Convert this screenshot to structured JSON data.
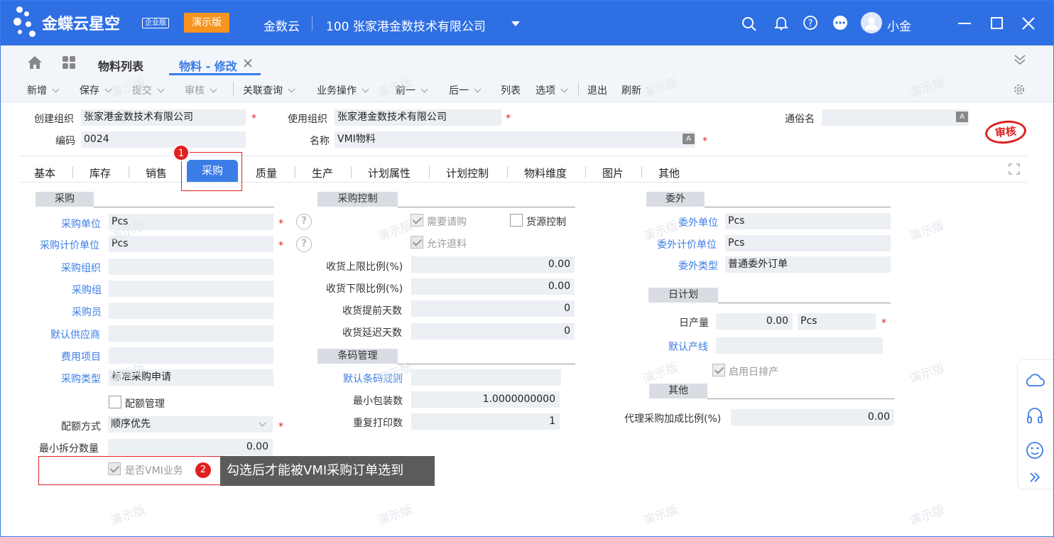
{
  "app": {
    "brand": "金蝶云星空",
    "edition": "企业版",
    "demo": "演示版",
    "product": "金数云",
    "company": "100 张家港金数技术有限公司",
    "user": "小金"
  },
  "tabs": {
    "list": "物料列表",
    "edit": "物料 - 修改"
  },
  "toolbar": {
    "new": "新增",
    "save": "保存",
    "submit": "提交",
    "audit": "审核",
    "query": "关联查询",
    "ops": "业务操作",
    "prev": "前一",
    "next": "后一",
    "list": "列表",
    "options": "选项",
    "exit": "退出",
    "refresh": "刷新"
  },
  "header": {
    "create_org_label": "创建组织",
    "create_org": "张家港金数技术有限公司",
    "use_org_label": "使用组织",
    "use_org": "张家港金数技术有限公司",
    "alias_label": "通俗名",
    "alias": "",
    "code_label": "编码",
    "code": "0024",
    "name_label": "名称",
    "name": "VMI物料",
    "stamp": "审核"
  },
  "ctabs": [
    "基本",
    "库存",
    "销售",
    "采购",
    "质量",
    "生产",
    "计划属性",
    "计划控制",
    "物料维度",
    "图片",
    "其他"
  ],
  "purchase": {
    "title": "采购",
    "unit_label": "采购单位",
    "unit": "Pcs",
    "price_unit_label": "采购计价单位",
    "price_unit": "Pcs",
    "org_label": "采购组织",
    "org": "",
    "group_label": "采购组",
    "group": "",
    "buyer_label": "采购员",
    "buyer": "",
    "supplier_label": "默认供应商",
    "supplier": "",
    "expense_label": "费用项目",
    "expense": "",
    "type_label": "采购类型",
    "type": "标准采购申请",
    "quota_label": "配额管理",
    "quota_mode_label": "配额方式",
    "quota_mode": "顺序优先",
    "min_split_label": "最小拆分数量",
    "min_split": "0.00",
    "vmi_label": "是否VMI业务"
  },
  "control": {
    "title": "采购控制",
    "need_req": "需要请购",
    "source_ctrl": "货源控制",
    "allow_return": "允许退料",
    "upper_label": "收货上限比例(%)",
    "upper": "0.00",
    "lower_label": "收货下限比例(%)",
    "lower": "0.00",
    "ahead_label": "收货提前天数",
    "ahead": "0",
    "delay_label": "收货延迟天数",
    "delay": "0"
  },
  "barcode": {
    "title": "条码管理",
    "rule_label": "默认条码规则",
    "rule": "",
    "min_pack_label": "最小包装数",
    "min_pack": "1.0000000000",
    "reprint_label": "重复打印数",
    "reprint": "1"
  },
  "outsource": {
    "title": "委外",
    "unit_label": "委外单位",
    "unit": "Pcs",
    "price_unit_label": "委外计价单位",
    "price_unit": "Pcs",
    "type_label": "委外类型",
    "type": "普通委外订单"
  },
  "daily": {
    "title": "日计划",
    "output_label": "日产量",
    "output": "0.00",
    "output_unit": "Pcs",
    "line_label": "默认产线",
    "line": "",
    "enable_label": "启用日排产"
  },
  "other": {
    "title": "其他",
    "rate_label": "代理采购加成比例(%)",
    "rate": "0.00"
  },
  "annotations": {
    "step1": "1",
    "step2": "2",
    "tip": "勾选后才能被VMI采购订单选到"
  },
  "colors": {
    "brand_blue": "#2f6fe4",
    "demo_orange": "#f7931e",
    "active_tab": "#3b7de6",
    "annotation_red": "#e02020"
  }
}
